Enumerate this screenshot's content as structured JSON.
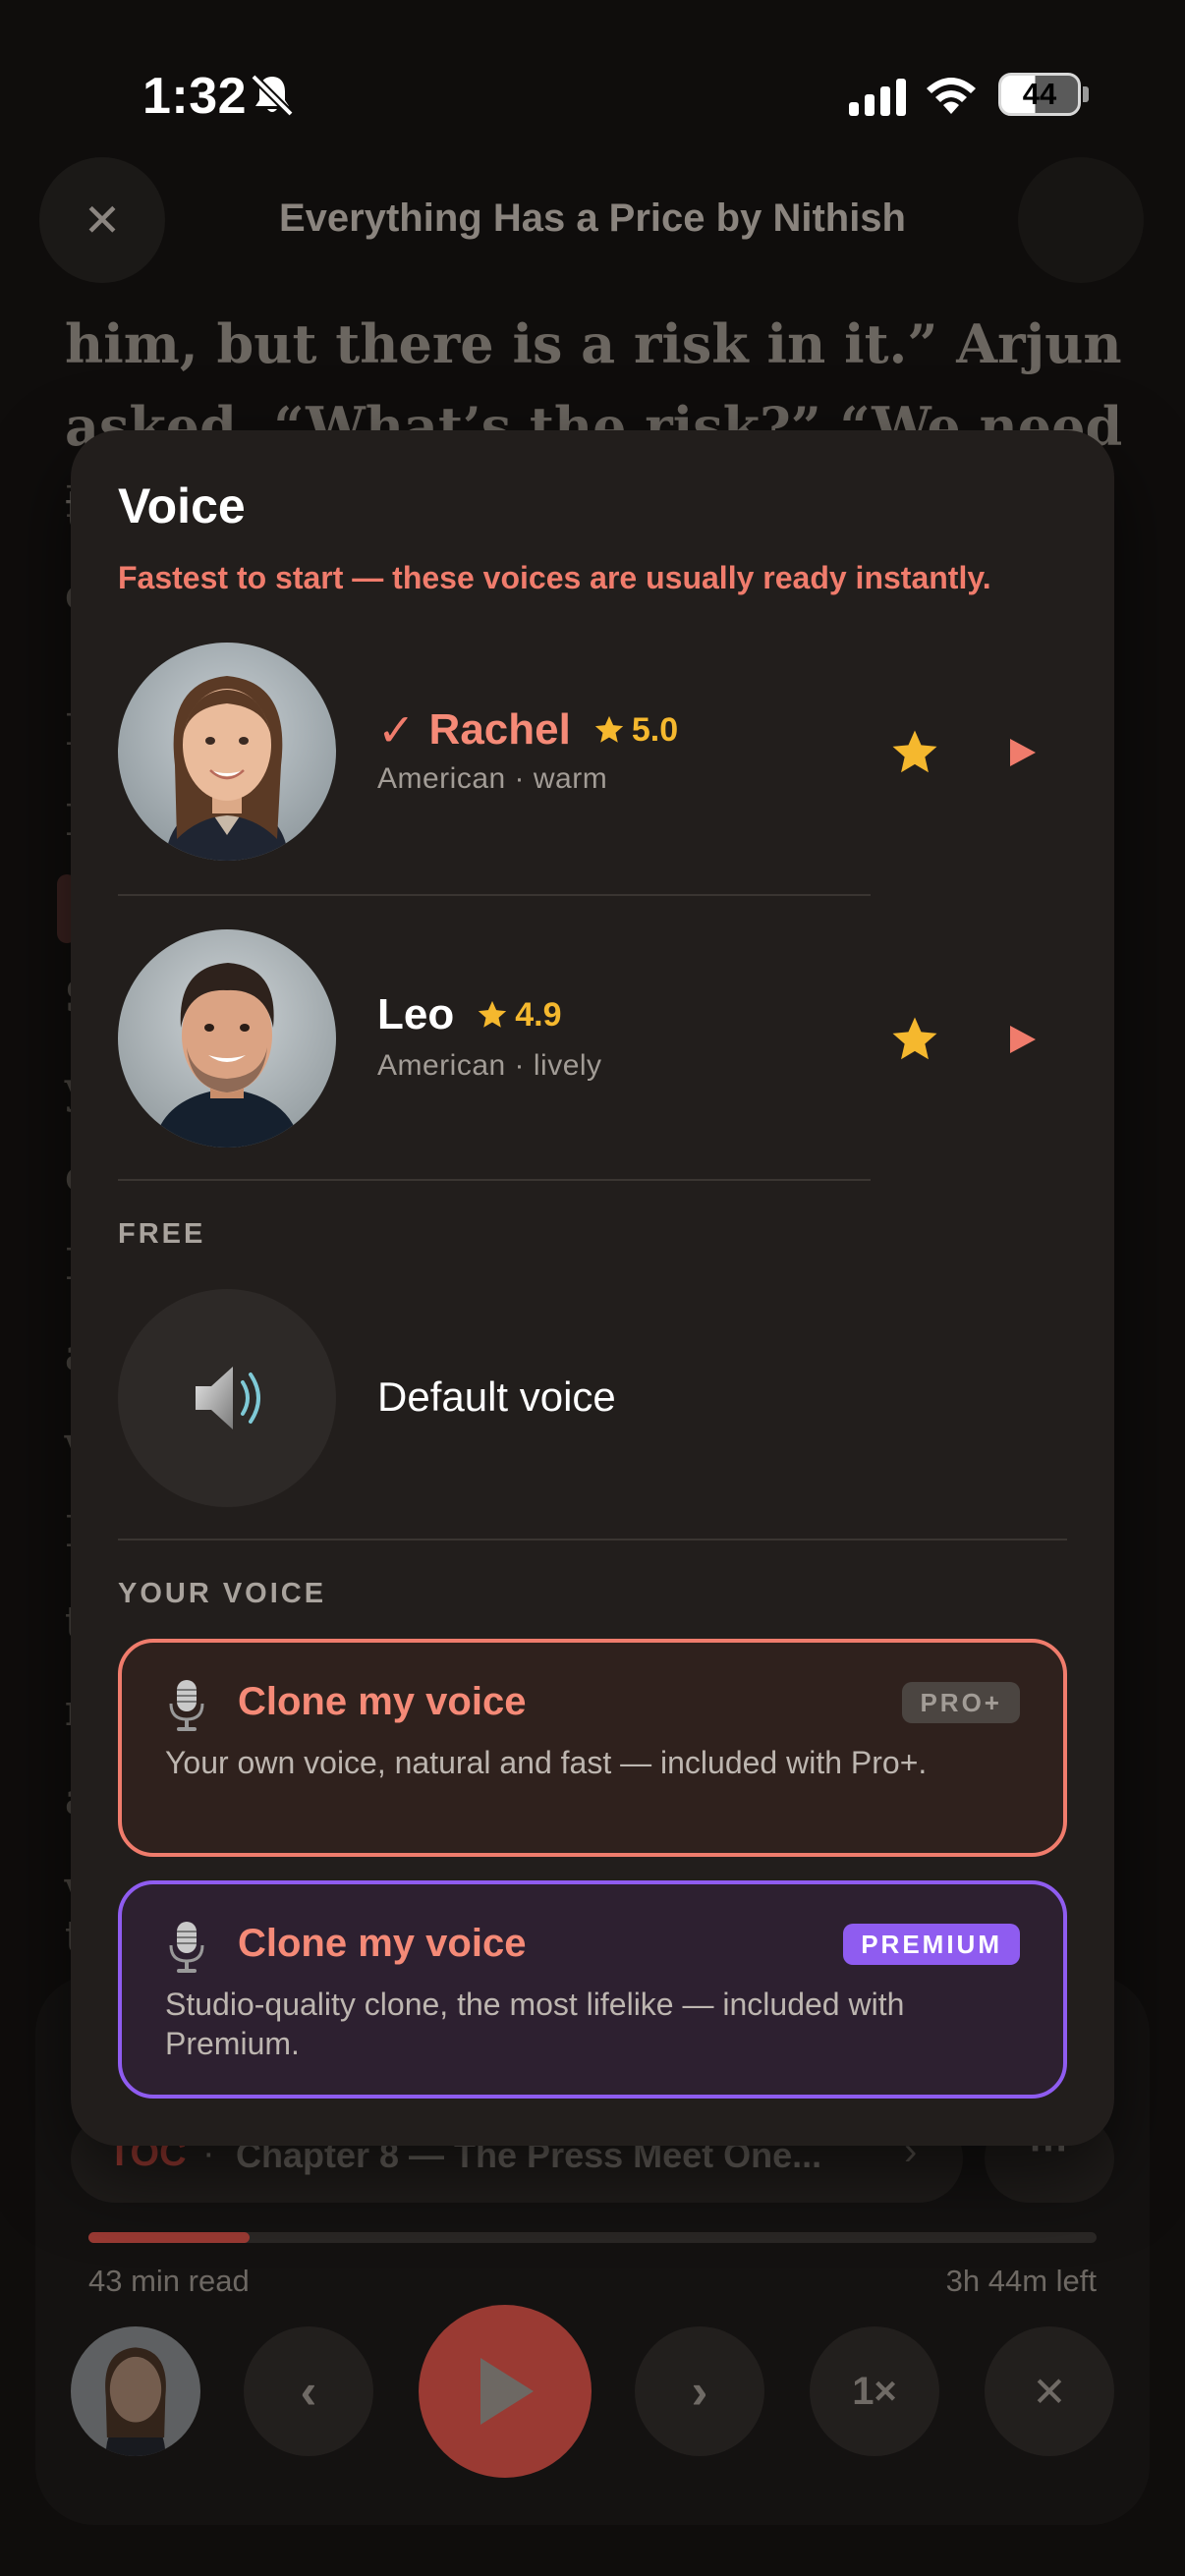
{
  "status_bar": {
    "time": "1:32",
    "battery": "44"
  },
  "reader": {
    "book_title": "Everything Has a Price by Nithish",
    "text_line_1": "him, but there is a risk in it.” Arjun",
    "text_line_2": "asked, “What’s the risk?” “We need to",
    "ghost_letters": [
      "I",
      "c",
      "I",
      "I",
      "c",
      "S",
      "y",
      "c",
      "I",
      "a",
      "v",
      "I",
      "t",
      "r",
      "a",
      "v",
      "t"
    ]
  },
  "player": {
    "toc_label": "TOC",
    "toc_separator": "·",
    "chapter": "Chapter 8 — The Press Meet One...",
    "chevron": "›",
    "more": "···",
    "progress_fraction": 0.16,
    "read_time": "43 min read",
    "time_left": "3h 44m left",
    "prev": "‹",
    "next": "›",
    "speed": "1×",
    "close": "✕"
  },
  "sheet": {
    "title": "Voice",
    "subtitle": "Fastest to start — these voices are usually ready instantly.",
    "voices": [
      {
        "name": "Rachel",
        "rating": "5.0",
        "desc": "American · warm",
        "selected": true
      },
      {
        "name": "Leo",
        "rating": "4.9",
        "desc": "American · lively",
        "selected": false
      }
    ],
    "free_label": "FREE",
    "default_voice": "Default voice",
    "your_voice_label": "YOUR VOICE",
    "clone_pro": {
      "title": "Clone my voice",
      "badge": "PRO+",
      "desc": "Your own voice, natural and fast — included with Pro+."
    },
    "clone_premium": {
      "title": "Clone my voice",
      "badge": "PREMIUM",
      "desc": "Studio-quality clone, the most lifelike — included with Premium."
    }
  },
  "colors": {
    "accent": "#f07c6c",
    "star": "#f5b82e",
    "premium": "#8f5cf0",
    "sheet_bg": "#221e1c"
  },
  "icons": [
    "close-icon",
    "bell-slash-icon",
    "signal-icon",
    "wifi-icon",
    "battery-icon",
    "checkmark-icon",
    "star-icon",
    "play-icon",
    "speaker-icon",
    "microphone-icon"
  ]
}
